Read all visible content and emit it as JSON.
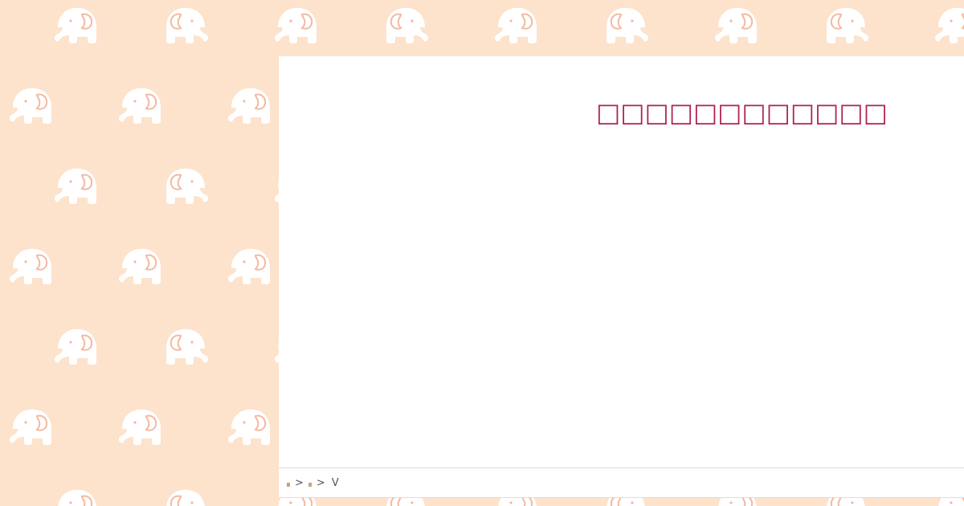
{
  "page": {
    "title": "□□□□□□□□□□□□",
    "background_color": "#fde2cc",
    "accent_color": "#b0234f",
    "pattern_icon": "elephant-icon"
  },
  "breadcrumb": {
    "items": [
      {
        "icon": "home-icon"
      },
      {
        "icon": "folder-icon"
      }
    ],
    "separator": ">",
    "current": "V"
  }
}
